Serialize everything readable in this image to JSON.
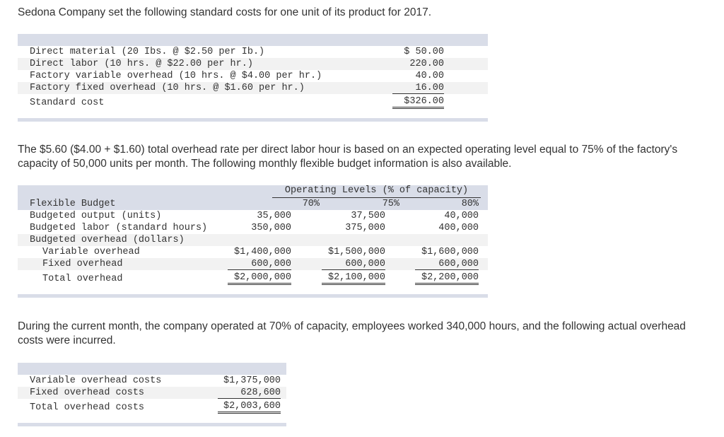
{
  "intro": "Sedona Company set the following standard costs for one unit of its product for 2017.",
  "standard_costs": {
    "rows": [
      {
        "label": "Direct material (20 Ibs. @ $2.50 per Ib.)",
        "value": "$ 50.00"
      },
      {
        "label": "Direct labor (10 hrs. @ $22.00 per hr.)",
        "value": "220.00"
      },
      {
        "label": "Factory variable overhead (10 hrs. @ $4.00 per hr.)",
        "value": "40.00"
      },
      {
        "label": "Factory fixed overhead (10 hrs. @ $1.60 per hr.)",
        "value": "16.00"
      }
    ],
    "total": {
      "label": "Standard cost",
      "value": "$326.00"
    }
  },
  "paragraph2": "The $5.60 ($4.00 + $1.60) total overhead rate per direct labor hour is based on an expected operating level equal to 75% of the factory's capacity of 50,000 units per month. The following monthly flexible budget information is also available.",
  "flexible_budget": {
    "group_header": "Operating Levels (% of capacity)",
    "title": "Flexible Budget",
    "columns": [
      "70%",
      "75%",
      "80%"
    ],
    "rows": [
      {
        "label": "Budgeted output (units)",
        "values": [
          "35,000",
          "37,500",
          "40,000"
        ]
      },
      {
        "label": "Budgeted labor (standard hours)",
        "values": [
          "350,000",
          "375,000",
          "400,000"
        ]
      },
      {
        "label": "Budgeted overhead (dollars)",
        "values": [
          "",
          "",
          ""
        ]
      },
      {
        "label": "Variable overhead",
        "values": [
          "$1,400,000",
          "$1,500,000",
          "$1,600,000"
        ]
      },
      {
        "label": "Fixed overhead",
        "values": [
          "600,000",
          "600,000",
          "600,000"
        ]
      }
    ],
    "total": {
      "label": "Total overhead",
      "values": [
        "$2,000,000",
        "$2,100,000",
        "$2,200,000"
      ]
    }
  },
  "paragraph3": "During the current month, the company operated at 70% of capacity, employees worked 340,000 hours, and the following actual overhead costs were incurred.",
  "actual_costs": {
    "rows": [
      {
        "label": "Variable overhead costs",
        "value": "$1,375,000"
      },
      {
        "label": "Fixed overhead costs",
        "value": "628,600"
      }
    ],
    "total": {
      "label": "Total overhead costs",
      "value": "$2,003,600"
    }
  }
}
